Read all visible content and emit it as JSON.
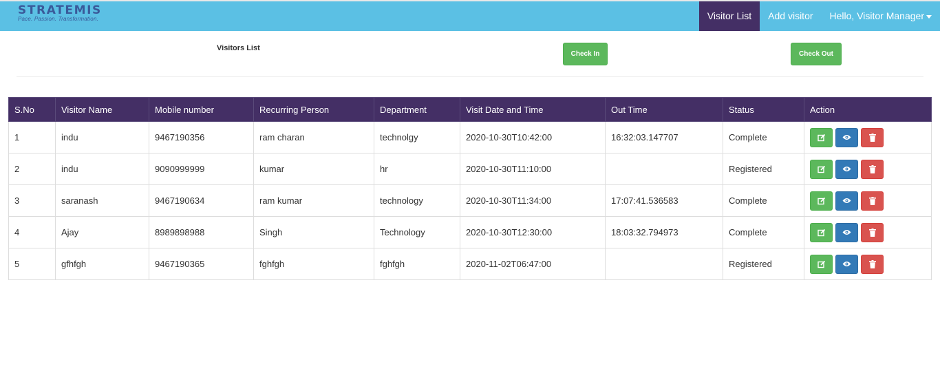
{
  "header": {
    "logo_text": "STRATEMIS",
    "logo_tagline": "Pace. Passion. Transformation.",
    "nav": {
      "visitor_list": "Visitor List",
      "add_visitor": "Add visitor",
      "user_menu": "Hello, Visitor Manager"
    }
  },
  "page": {
    "title": "Visitors List",
    "check_in_label": "Check In",
    "check_out_label": "Check Out"
  },
  "table": {
    "columns": [
      "S.No",
      "Visitor Name",
      "Mobile number",
      "Recurring Person",
      "Department",
      "Visit Date and Time",
      "Out Time",
      "Status",
      "Action"
    ],
    "rows": [
      {
        "sno": "1",
        "name": "indu",
        "mobile": "9467190356",
        "person": "ram charan",
        "department": "technolgy",
        "visit": "2020-10-30T10:42:00",
        "out": "16:32:03.147707",
        "status": "Complete"
      },
      {
        "sno": "2",
        "name": "indu",
        "mobile": "9090999999",
        "person": "kumar",
        "department": "hr",
        "visit": "2020-10-30T11:10:00",
        "out": "",
        "status": "Registered"
      },
      {
        "sno": "3",
        "name": "saranash",
        "mobile": "9467190634",
        "person": "ram kumar",
        "department": "technology",
        "visit": "2020-10-30T11:34:00",
        "out": "17:07:41.536583",
        "status": "Complete"
      },
      {
        "sno": "4",
        "name": "Ajay",
        "mobile": "8989898988",
        "person": "Singh",
        "department": "Technology",
        "visit": "2020-10-30T12:30:00",
        "out": "18:03:32.794973",
        "status": "Complete"
      },
      {
        "sno": "5",
        "name": "gfhfgh",
        "mobile": "9467190365",
        "person": "fghfgh",
        "department": "fghfgh",
        "visit": "2020-11-02T06:47:00",
        "out": "",
        "status": "Registered"
      }
    ]
  },
  "icons": {
    "edit": "edit-icon",
    "view": "eye-icon",
    "delete": "trash-icon"
  },
  "colors": {
    "navbar": "#5bc0e4",
    "accent": "#442f65",
    "success": "#5cb85c",
    "primary": "#337ab7",
    "danger": "#d9534f"
  }
}
